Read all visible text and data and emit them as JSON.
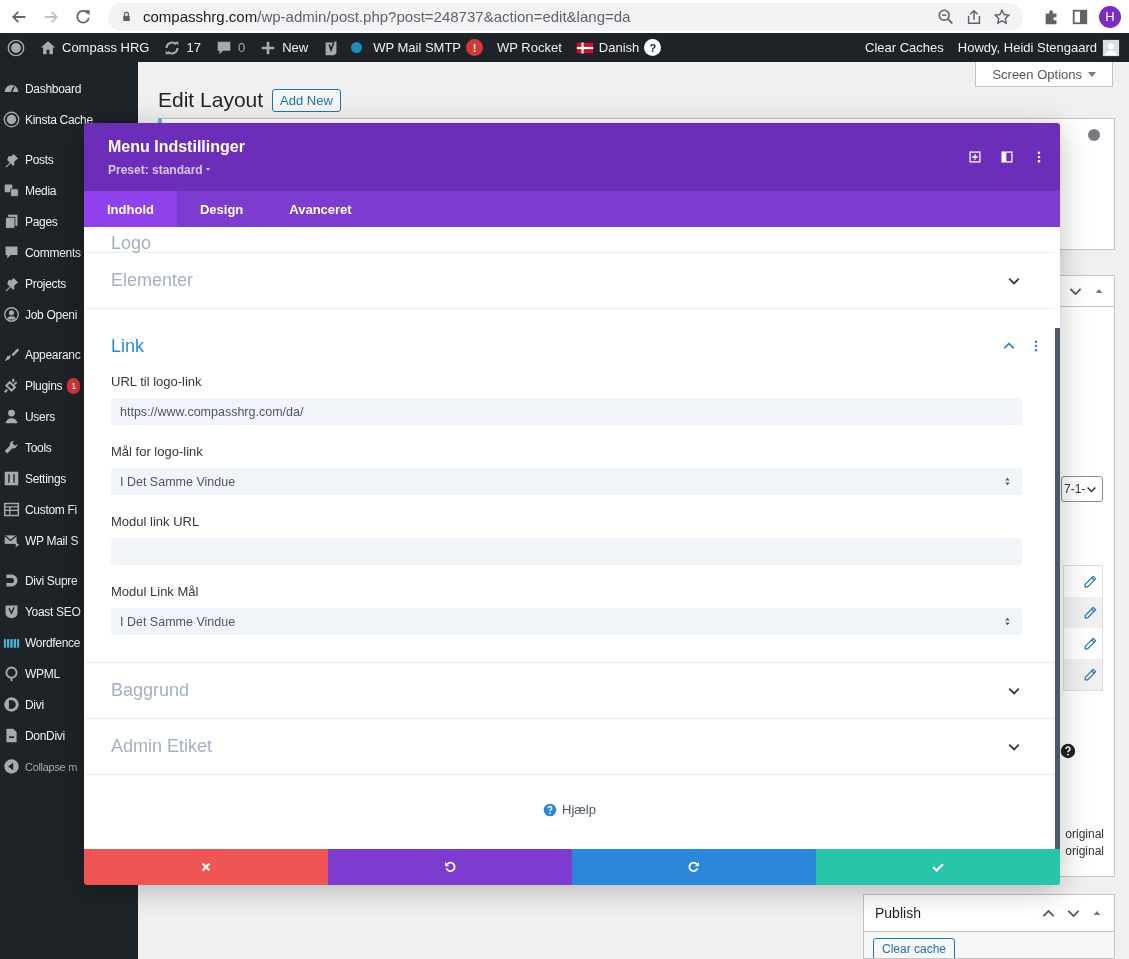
{
  "browser": {
    "nav": [
      {
        "kind": "back",
        "disabled": false
      },
      {
        "kind": "forward",
        "disabled": true
      },
      {
        "kind": "reload",
        "disabled": false
      }
    ],
    "url_host": "compasshrg.com",
    "url_path": "/wp-admin/post.php?post=248737&action=edit&lang=da",
    "profile_initial": "H"
  },
  "admin_bar": {
    "items": [
      {
        "kind": "logo"
      },
      {
        "kind": "home",
        "label": "Compass HRG"
      },
      {
        "kind": "updates",
        "label": "17"
      },
      {
        "kind": "comments",
        "label": "0"
      },
      {
        "kind": "new",
        "label": "New"
      },
      {
        "kind": "plugin-logo"
      },
      {
        "kind": "dot"
      },
      {
        "kind": "plain",
        "label": "WP Mail SMTP",
        "badge": "!"
      },
      {
        "kind": "plain",
        "label": "WP Rocket"
      },
      {
        "kind": "flag",
        "label": "Danish",
        "badge": "?"
      }
    ],
    "right": [
      {
        "kind": "plain",
        "label": "Clear Caches"
      },
      {
        "kind": "account",
        "label": "Howdy, Heidi Stengaard"
      }
    ]
  },
  "sidebar": {
    "groups": [
      [
        {
          "label": "Dashboard"
        },
        {
          "label": "Kinsta Cache"
        }
      ],
      [
        {
          "label": "Posts"
        },
        {
          "label": "Media"
        },
        {
          "label": "Pages"
        },
        {
          "label": "Comments"
        },
        {
          "label": "Projects"
        },
        {
          "label": "Job Openi"
        }
      ],
      [
        {
          "label": "Appearanc"
        },
        {
          "label": "Plugins",
          "badge": "1"
        },
        {
          "label": "Users"
        },
        {
          "label": "Tools"
        },
        {
          "label": "Settings"
        },
        {
          "label": "Custom Fi"
        },
        {
          "label": "WP Mail S"
        }
      ],
      [
        {
          "label": "Divi Supre"
        },
        {
          "label": "Yoast SEO"
        },
        {
          "label": "Wordfence"
        },
        {
          "label": "WPML"
        },
        {
          "label": "Divi"
        },
        {
          "label": "DonDivi"
        },
        {
          "label": "Collapse m",
          "kind": "collapse"
        }
      ]
    ]
  },
  "page": {
    "title": "Edit Layout",
    "add_new": "Add New",
    "screen_options": "Screen Options",
    "side": {
      "select_value": "7-1-",
      "notes": [
        "original",
        "original"
      ]
    },
    "publish": {
      "title": "Publish",
      "button": "Clear cache"
    }
  },
  "modal": {
    "title": "Menu Indstillinger",
    "preset": "Preset: standard",
    "tabs": [
      {
        "label": "Indhold",
        "selected": true
      },
      {
        "label": "Design",
        "selected": false
      },
      {
        "label": "Avanceret",
        "selected": false
      }
    ],
    "sections": [
      {
        "title": "Logo",
        "expanded": false
      },
      {
        "title": "Elementer",
        "expanded": false
      },
      {
        "title": "Link",
        "expanded": true,
        "fields": [
          {
            "label": "URL til logo-link",
            "kind": "text",
            "value": "https://www.compasshrg.com/da/"
          },
          {
            "label": "Mål for logo-link",
            "kind": "select",
            "value": "I Det Samme Vindue"
          },
          {
            "label": "Modul link URL",
            "kind": "text"
          },
          {
            "label": "Modul Link Mål",
            "kind": "select",
            "value": "I Det Samme Vindue"
          }
        ]
      },
      {
        "title": "Baggrund",
        "expanded": false
      },
      {
        "title": "Admin Etiket",
        "expanded": false
      }
    ],
    "help": "Hjælp",
    "actions": [
      {
        "kind": "cancel"
      },
      {
        "kind": "undo"
      },
      {
        "kind": "redo"
      },
      {
        "kind": "save"
      }
    ]
  }
}
